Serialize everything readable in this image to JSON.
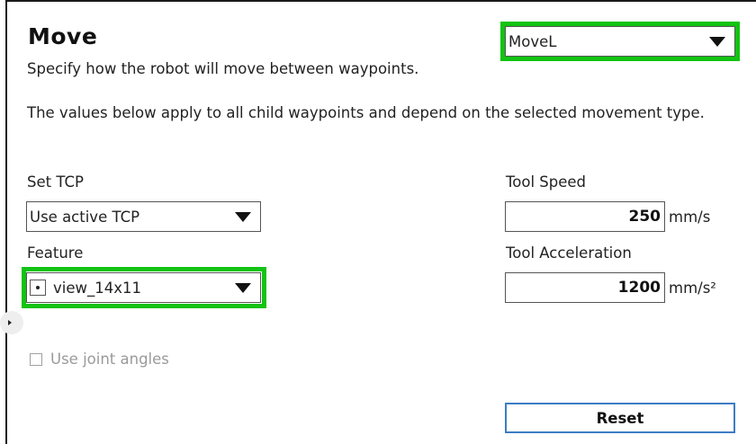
{
  "header": {
    "title": "Move",
    "subtitle": "Specify how the robot will move between waypoints.",
    "description": "The values below apply to all child waypoints and depend on the selected movement type."
  },
  "movement_type": {
    "selected": "MoveL"
  },
  "tcp": {
    "label": "Set TCP",
    "selected": "Use active TCP"
  },
  "feature": {
    "label": "Feature",
    "selected": "view_14x11"
  },
  "tool_speed": {
    "label": "Tool Speed",
    "value": "250",
    "unit": "mm/s"
  },
  "tool_acceleration": {
    "label": "Tool Acceleration",
    "value": "1200",
    "unit": "mm/s²"
  },
  "joint_angles": {
    "label": "Use joint angles",
    "checked": false,
    "enabled": false
  },
  "buttons": {
    "reset_label": "Reset"
  },
  "colors": {
    "highlight": "#12c312",
    "button_border": "#3b7dc4",
    "disabled_text": "#9a9a9a"
  },
  "icons": {
    "dropdown_caret": "caret-down-icon",
    "feature_point": "point-feature-icon",
    "collapse": "chevron-right-icon"
  }
}
